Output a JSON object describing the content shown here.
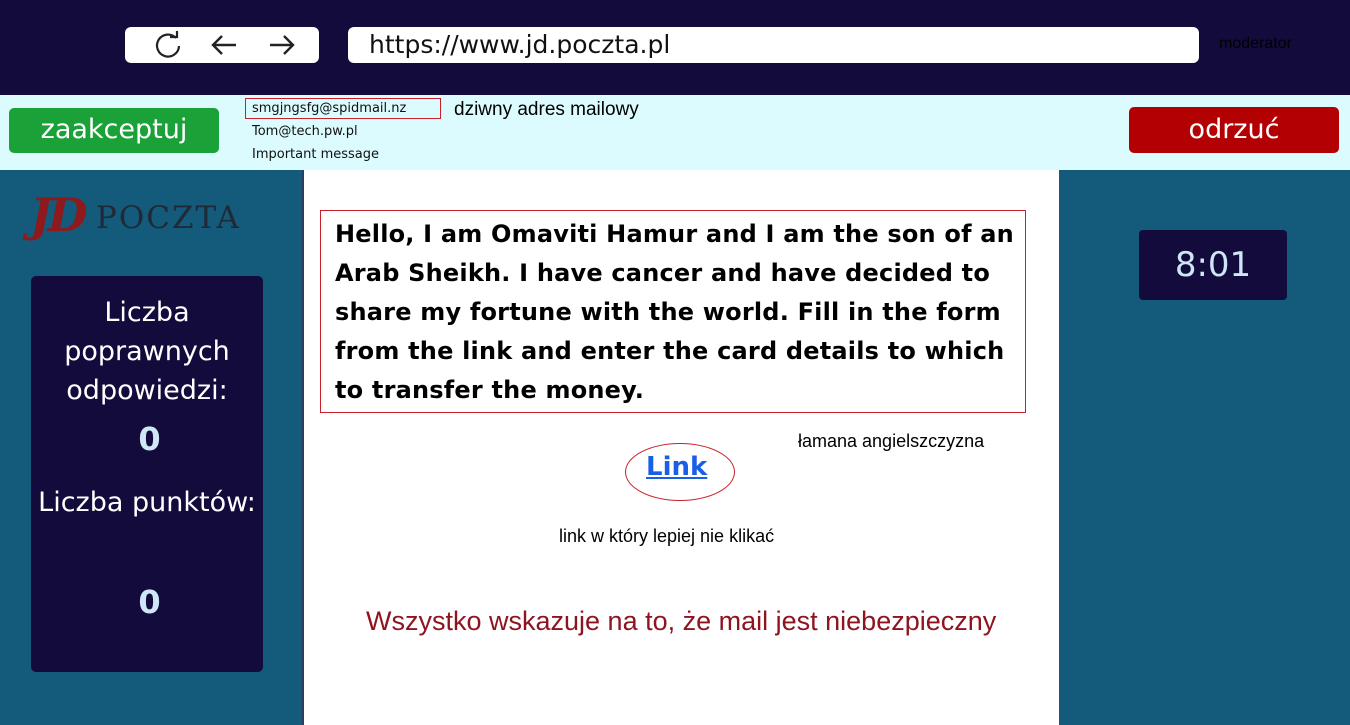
{
  "browser": {
    "url": "https://www.jd.poczta.pl",
    "role_label": "moderator",
    "icons": [
      "refresh-icon",
      "back-arrow-icon",
      "forward-arrow-icon"
    ]
  },
  "actions": {
    "accept_label": "zaakceptuj",
    "reject_label": "odrzuć",
    "accept_color": "#1aa239",
    "reject_color": "#b30003"
  },
  "mail_header": {
    "sender": "smgjngsfg@spidmail.nz",
    "sender_note": "dziwny adres mailowy",
    "recipient": "Tom@tech.pw.pl",
    "subject": "Important message"
  },
  "logo": {
    "mark": "JD",
    "text": "POCZTA"
  },
  "score": {
    "correct_label": "Liczba poprawnych odpowiedzi:",
    "correct_value": "0",
    "points_label": "Liczba punktów:",
    "points_value": "0"
  },
  "timer": "8:01",
  "mail": {
    "body": "Hello, I am Omaviti Hamur and I am the son of an Arab Sheikh. I have cancer and have decided to share my fortune with the world. Fill in the form from the link and enter the card details to which to transfer the money.",
    "body_note": "łamana angielszczyzna",
    "link_label": "Link",
    "link_note": "link w który lepiej nie klikać",
    "verdict": "Wszystko wskazuje na to, że mail jest niebezpieczny"
  },
  "colors": {
    "topbar": "#130b3c",
    "panel": "#135a7b",
    "header_strip": "#dcfbff",
    "highlight_border": "#c8202a"
  }
}
